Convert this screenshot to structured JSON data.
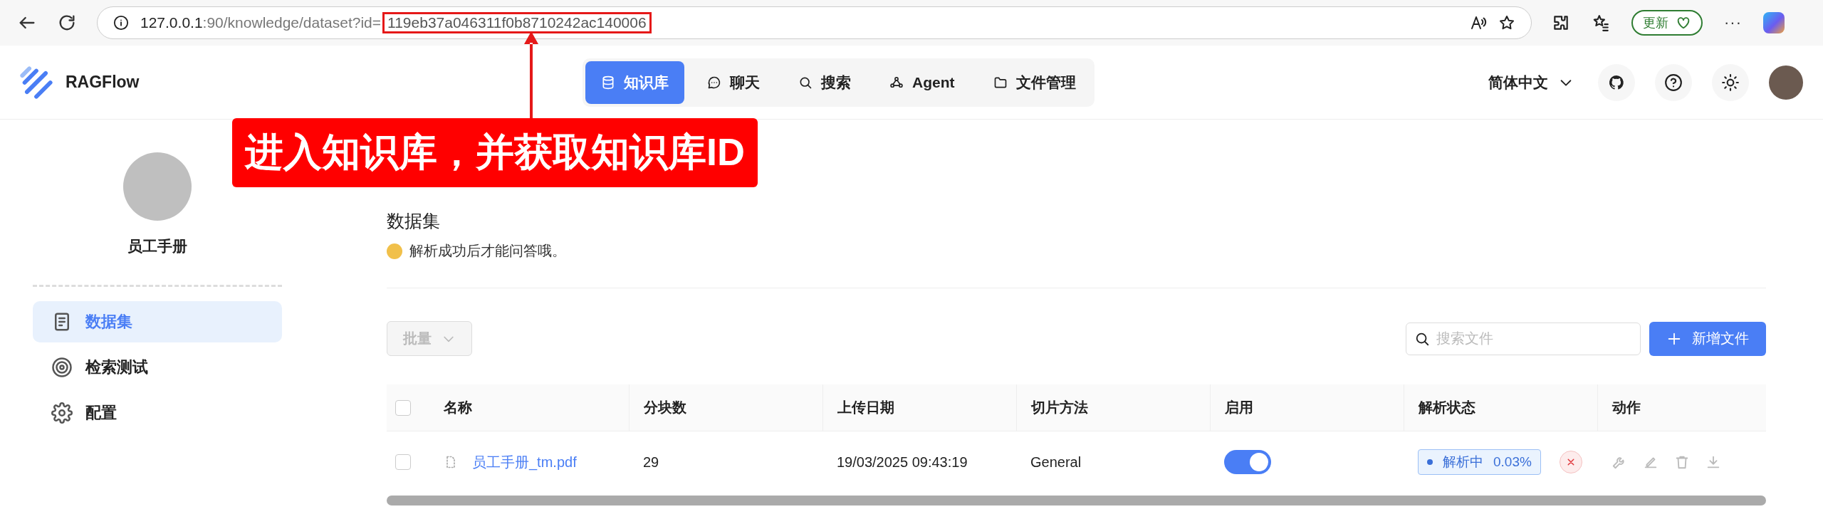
{
  "browser": {
    "url_host": "127.0.0.1",
    "url_path": ":90/knowledge/dataset?id=",
    "url_id": "119eb37a046311f0b8710242ac140006",
    "update_label": "更新",
    "more_label": "···"
  },
  "annotation": {
    "label": "进入知识库，并获取知识库ID"
  },
  "header": {
    "brand": "RAGFlow",
    "nav": [
      {
        "label": "知识库",
        "selected": true
      },
      {
        "label": "聊天",
        "selected": false
      },
      {
        "label": "搜索",
        "selected": false
      },
      {
        "label": "Agent",
        "selected": false
      },
      {
        "label": "文件管理",
        "selected": false
      }
    ],
    "language": "简体中文"
  },
  "sidebar": {
    "name": "员工手册",
    "items": [
      {
        "label": "数据集",
        "selected": true
      },
      {
        "label": "检索测试",
        "selected": false
      },
      {
        "label": "配置",
        "selected": false
      }
    ]
  },
  "content": {
    "title": "数据集",
    "hint": "解析成功后才能问答哦。",
    "batch": {
      "label": "批量",
      "disabled": true
    },
    "search": {
      "placeholder": "搜索文件"
    },
    "add_button": "新增文件"
  },
  "table": {
    "header_checked": false,
    "columns": [
      "名称",
      "分块数",
      "上传日期",
      "切片方法",
      "启用",
      "解析状态",
      "动作"
    ],
    "rows": [
      {
        "checked": false,
        "name": "员工手册_tm.pdf",
        "chunks": "29",
        "date": "19/03/2025 09:43:19",
        "method": "General",
        "enabled": true,
        "status": "解析中",
        "progress": "0.03%"
      }
    ]
  }
}
